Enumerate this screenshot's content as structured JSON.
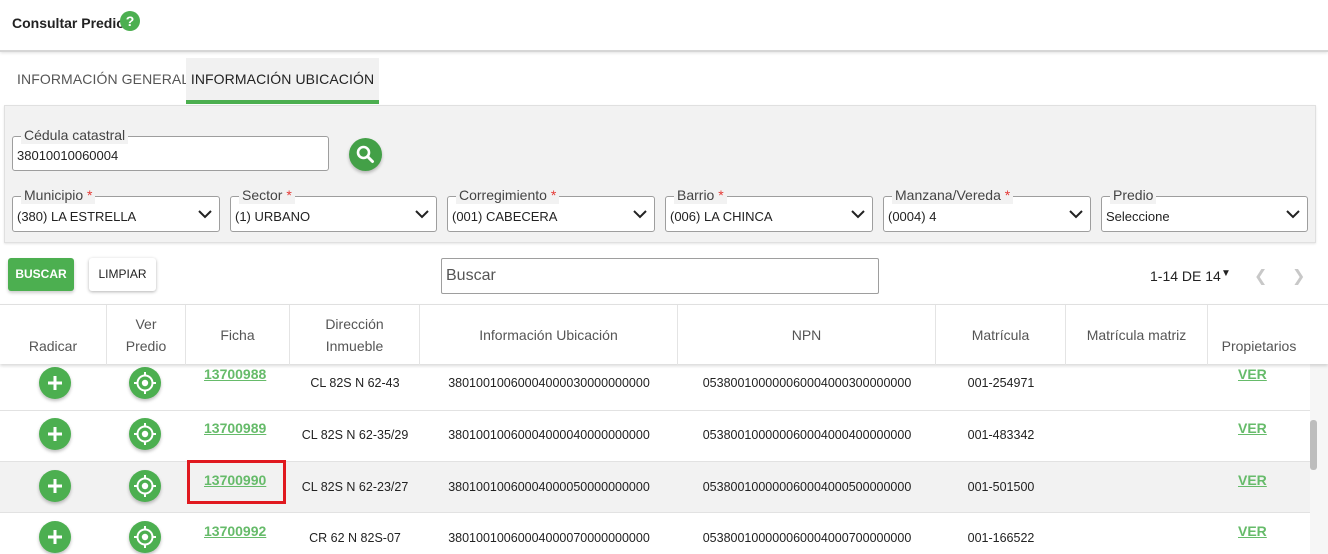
{
  "header": {
    "title": "Consultar Predio",
    "help_glyph": "?"
  },
  "tabs": [
    {
      "label": "INFORMACIÓN GENERAL",
      "active": false
    },
    {
      "label": "INFORMACIÓN UBICACIÓN",
      "active": true
    }
  ],
  "filters": {
    "cedula": {
      "label": "Cédula catastral",
      "value": "38010010060004"
    },
    "municipio": {
      "label": "Municipio",
      "required": "*",
      "value": "(380) LA ESTRELLA"
    },
    "sector": {
      "label": "Sector",
      "required": "*",
      "value": "(1) URBANO"
    },
    "corregimiento": {
      "label": "Corregimiento",
      "required": "*",
      "value": "(001) CABECERA"
    },
    "barrio": {
      "label": "Barrio",
      "required": "*",
      "value": "(006) LA CHINCA"
    },
    "manzana": {
      "label": "Manzana/Vereda",
      "required": "*",
      "value": "(0004) 4"
    },
    "predio": {
      "label": "Predio",
      "value": "Seleccione"
    }
  },
  "actions": {
    "buscar_label": "BUSCAR",
    "limpiar_label": "LIMPIAR",
    "search_placeholder": "Buscar"
  },
  "pagination": {
    "label": "1-14 DE 14"
  },
  "table": {
    "columns": {
      "radicar": "Radicar",
      "ver_predio_1": "Ver",
      "ver_predio_2": "Predio",
      "ficha": "Ficha",
      "direccion_1": "Dirección",
      "direccion_2": "Inmueble",
      "info_ubicacion": "Información Ubicación",
      "npn": "NPN",
      "matricula": "Matrícula",
      "matricula_matriz": "Matrícula matriz",
      "propietarios": "Propietarios"
    },
    "rows": [
      {
        "ficha": "13700988",
        "direccion": "CL 82S N 62-43",
        "info": "38010010060004000030000000000",
        "npn": "053800100000060004000300000000",
        "matricula": "001-254971",
        "matricula_matriz": "",
        "propietarios": "VER"
      },
      {
        "ficha": "13700989",
        "direccion": "CL 82S N 62-35/29",
        "info": "38010010060004000040000000000",
        "npn": "053800100000060004000400000000",
        "matricula": "001-483342",
        "matricula_matriz": "",
        "propietarios": "VER"
      },
      {
        "ficha": "13700990",
        "direccion": "CL 82S N 62-23/27",
        "info": "38010010060004000050000000000",
        "npn": "053800100000060004000500000000",
        "matricula": "001-501500",
        "matricula_matriz": "",
        "propietarios": "VER"
      },
      {
        "ficha": "13700992",
        "direccion": "CR 62 N 82S-07",
        "info": "38010010060004000070000000000",
        "npn": "053800100000060004000700000000",
        "matricula": "001-166522",
        "matricula_matriz": "",
        "propietarios": "VER"
      }
    ]
  },
  "colors": {
    "accent_green": "#4caf50",
    "link_green": "#66bb6a",
    "highlight_red": "#e0191f",
    "required_red": "#e53935"
  }
}
